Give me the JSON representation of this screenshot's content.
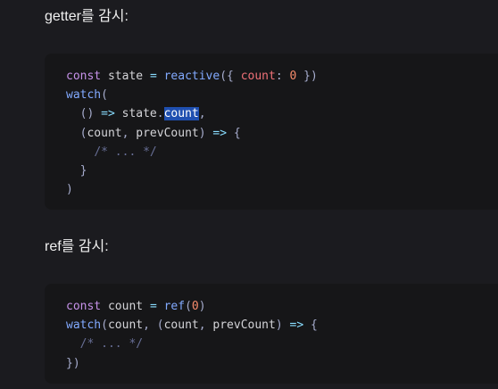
{
  "headings": {
    "watch_getter": "getter를 감시:",
    "watch_ref": "ref를 감시:"
  },
  "block1": {
    "l1": {
      "kw": "const",
      "name": "state",
      "eq": "=",
      "fn": "reactive",
      "open": "({",
      "prop": "count",
      "colon": ":",
      "num": "0",
      "close": "})"
    },
    "l2": {
      "fn": "watch",
      "open": "("
    },
    "l3": {
      "parens": "()",
      "arrow": "=>",
      "obj": "state",
      "dot": ".",
      "selected": "count",
      "comma": ","
    },
    "l4": {
      "open": "(",
      "p1": "count",
      "comma": ",",
      "p2": "prevCount",
      "close": ")",
      "arrow": "=>",
      "brace": "{"
    },
    "l5": {
      "comment": "/* ... */"
    },
    "l6": {
      "brace": "}"
    },
    "l7": {
      "paren": ")"
    }
  },
  "block2": {
    "l1": {
      "kw": "const",
      "name": "count",
      "eq": "=",
      "fn": "ref",
      "open": "(",
      "num": "0",
      "close": ")"
    },
    "l2": {
      "fn": "watch",
      "open": "(",
      "arg": "count",
      "comma": ",",
      "open2": "(",
      "p1": "count",
      "comma2": ",",
      "p2": "prevCount",
      "close": ")",
      "arrow": "=>",
      "brace": "{"
    },
    "l3": {
      "comment": "/* ... */"
    },
    "l4": {
      "close": "})"
    }
  }
}
